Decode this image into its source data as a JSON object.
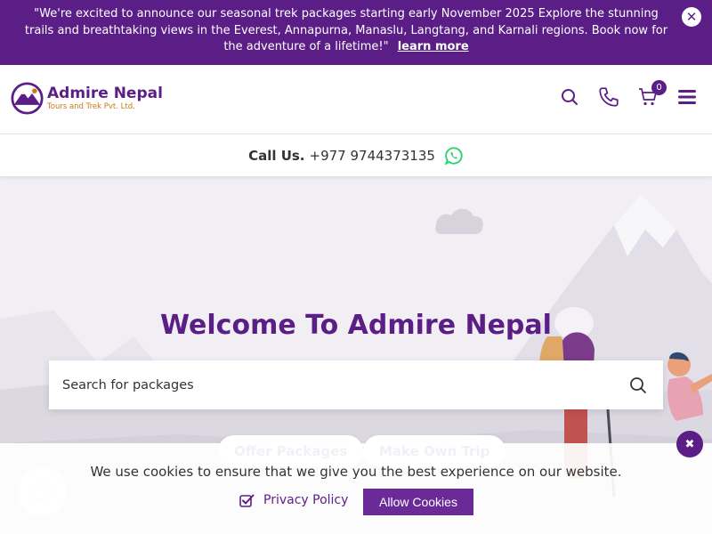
{
  "announcement": {
    "text": "\"We're excited to announce our seasonal trek packages starting early November 2025 Explore the stunning trails and breathtaking views in the Everest, Annapurna, Manaslu, Langtang, and Karnali regions. Book now for the adventure of a lifetime!\"",
    "link_label": "learn more",
    "close_label": "✕"
  },
  "header": {
    "logo_name": "Admire Nepal",
    "logo_tagline": "Tours and Trek Pvt. Ltd.",
    "cart_count": "0",
    "icons": [
      "search-icon",
      "phone-icon",
      "cart-icon",
      "hamburger-menu-icon"
    ]
  },
  "callbar": {
    "label": "Call Us.",
    "phone": "+977 9744373135"
  },
  "hero": {
    "title": "Welcome To Admire Nepal",
    "search_placeholder": "Search for packages",
    "offer_button": "Offer Packages",
    "custom_trip_button": "Make Own Trip"
  },
  "cookie": {
    "message": "We use cookies to ensure that we give you the best experience on our website.",
    "privacy_label": "Privacy Policy",
    "allow_label": "Allow Cookies",
    "close_label": "✖"
  },
  "colors": {
    "brand_purple": "#5b1e86",
    "accent_orange": "#c97b12",
    "whatsapp_green": "#25d366"
  }
}
